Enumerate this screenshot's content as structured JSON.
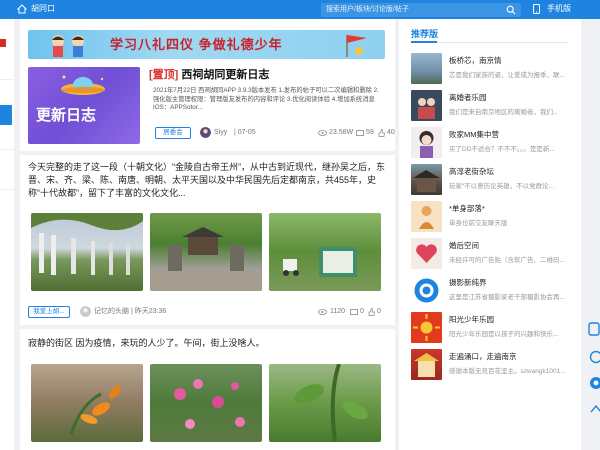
{
  "topbar": {
    "site_name": "胡同口",
    "search_placeholder": "搜索用户/板块/讨论版/帖子",
    "mobile_label": "手机版"
  },
  "banner": {
    "text": "学习八礼四仪  争做礼德少年"
  },
  "post1": {
    "thumb_text": "更新日志",
    "tag": "[置顶]",
    "title": "西祠胡同更新日志",
    "description": "2021年7月22日 西祠胡同APP 3.9.3版本发布 1.发布的帖子可以二次编辑和删除 2.强化版主管理权限：管理版友发布的内容和评论 3.优化阅读体验 4.增加系统消息 IOS：APPSotor...",
    "board_button": "居委会",
    "author": "Siyy",
    "date": "| 07-05",
    "views": "23.58W",
    "comments": "59",
    "likes": "40"
  },
  "post2": {
    "text": "今天完整的走了这一段（十朝文化）“金陵自古帝王州”，从中古到近现代，继孙吴之后，东晋、宋、齐、梁、陈、南唐、明朝、太平天国以及中华民国先后定都南京，共455年，史称“十代故都”，留下了丰富的文化文化...",
    "board_button": "我爱上胡...",
    "author": "记忆的头脑",
    "date": "| 昨天23:36",
    "views": "1120",
    "comments": "0",
    "likes": "0"
  },
  "post3": {
    "text": "寂静的街区 因为疫情，来玩的人少了。午间，街上没啥人。"
  },
  "sidebar": {
    "heading": "推荐版",
    "items": [
      {
        "name": "板桥芯，南京情",
        "desc": "芯是我们家族的姿，让爱成为报季，联..."
      },
      {
        "name": "离婚者乐园",
        "desc": "我们是来自南京地区的离婚者，我们..."
      },
      {
        "name": "败家MM集中营",
        "desc": "买了DD不适合？不不不。。。是是新..."
      },
      {
        "name": "高淳老街杂坛",
        "desc": "玩家“不以意历论英雄，不以党群论..."
      },
      {
        "name": "*单身部落*",
        "desc": "单身位前交友聊天版"
      },
      {
        "name": "婚后空间",
        "desc": "未经许可的广告贴（含软广告、二维码..."
      },
      {
        "name": "摄影新纯界",
        "desc": "这里是江苏省摄影家老干部摄影协会再..."
      },
      {
        "name": "阳光少年乐园",
        "desc": "阳光少年乐园是以孩子的兴趣和快乐..."
      },
      {
        "name": "走遍涌口，走遍南京",
        "desc": "感谢本版无竞百花坚主。szwangk1001..."
      }
    ]
  },
  "colors": {
    "brand_blue": "#1e84e0",
    "accent_red": "#e0322f"
  }
}
